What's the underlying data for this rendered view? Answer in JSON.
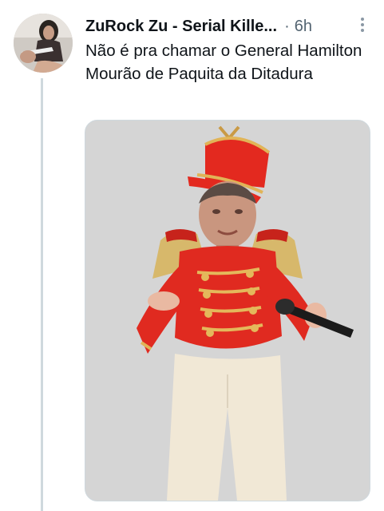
{
  "tweet": {
    "display_name": "ZuRock Zu - Serial Kille...",
    "separator": "·",
    "timestamp": "6h",
    "text": "Não é pra chamar o General Hamilton Mourão de Paquita da Ditadura"
  },
  "icons": {
    "more": "more-vertical-icon"
  },
  "colors": {
    "text_primary": "#0f1419",
    "text_secondary": "#536471",
    "thread_line": "#cfd9de",
    "media_background": "#d5d5d5",
    "costume_red": "#e0261d",
    "costume_gold": "#d8b25a"
  }
}
